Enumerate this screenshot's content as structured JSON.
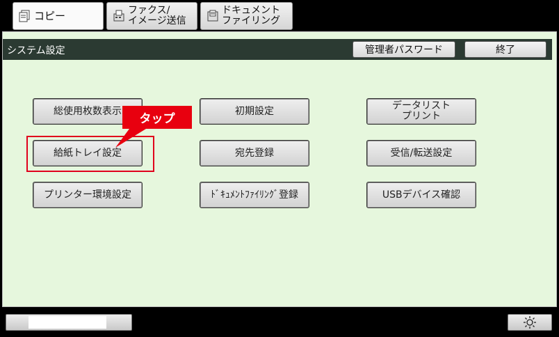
{
  "tabs": [
    {
      "label": "コピー",
      "icon": "copy-icon"
    },
    {
      "label": "ファクス/\nイメージ送信",
      "icon": "fax-icon"
    },
    {
      "label": "ドキュメント\nファイリング",
      "icon": "document-filing-icon"
    }
  ],
  "header": {
    "title": "システム設定",
    "admin_password_label": "管理者パスワード",
    "exit_label": "終了"
  },
  "menu": {
    "total_count": "総使用枚数表示",
    "initial_settings": "初期設定",
    "data_list_print": "データリスト\nプリント",
    "paper_tray": "給紙トレイ設定",
    "address_registration": "宛先登録",
    "receive_forward": "受信/転送設定",
    "printer_settings": "プリンター環境設定",
    "document_filing_registration": "ﾄﾞｷｭﾒﾝﾄﾌｧｲﾘﾝｸﾞ登録",
    "usb_device_check": "USBデバイス確認"
  },
  "annotation": {
    "callout": "タップ"
  },
  "footer": {
    "brightness_icon": "brightness-icon"
  },
  "colors": {
    "panel_bg": "#e6f7dd",
    "titlebar_bg": "#2b3a32",
    "callout_red": "#e8000f"
  }
}
